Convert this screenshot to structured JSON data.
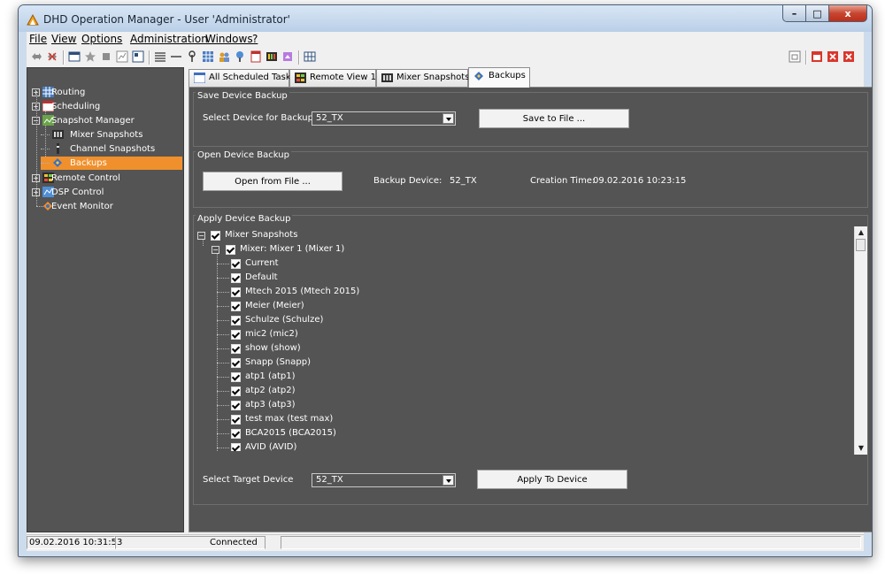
{
  "window": {
    "title": "DHD Operation Manager - User 'Administrator'",
    "buttons": {
      "minimize": "–",
      "maximize": "□",
      "close": "x"
    }
  },
  "menu": [
    "File",
    "View",
    "Options",
    "Administration",
    "Windows",
    "?"
  ],
  "sidebar": {
    "items": [
      {
        "label": "Routing",
        "icon": "routing-icon"
      },
      {
        "label": "Scheduling",
        "icon": "scheduling-icon"
      },
      {
        "label": "Snapshot Manager",
        "icon": "snapshot-manager-icon"
      },
      {
        "label": "Mixer Snapshots",
        "icon": "mixer-icon"
      },
      {
        "label": "Channel Snapshots",
        "icon": "channel-icon"
      },
      {
        "label": "Backups",
        "icon": "backups-icon",
        "selected": true
      },
      {
        "label": "Remote Control",
        "icon": "remote-control-icon"
      },
      {
        "label": "DSP Control",
        "icon": "dsp-control-icon"
      },
      {
        "label": "Event Monitor",
        "icon": "event-monitor-icon"
      }
    ]
  },
  "tabs": [
    {
      "label": "All Scheduled Tasks"
    },
    {
      "label": "Remote View 1"
    },
    {
      "label": "Mixer Snapshots"
    },
    {
      "label": "Backups",
      "active": true
    }
  ],
  "save_backup": {
    "group_title": "Save Device Backup",
    "select_label": "Select Device for Backup",
    "device_value": "52_TX",
    "save_button": "Save to File ..."
  },
  "open_backup": {
    "group_title": "Open Device Backup",
    "open_button": "Open from File ...",
    "backup_device_label": "Backup Device:",
    "backup_device_value": "52_TX",
    "creation_time_label": "Creation Time:",
    "creation_time_value": "09.02.2016 10:23:15"
  },
  "apply_backup": {
    "group_title": "Apply Device Backup",
    "root": "Mixer Snapshots",
    "mixer": "Mixer: Mixer 1 (Mixer 1)",
    "snapshots": [
      "Current",
      "Default",
      "Mtech  2015 (Mtech  2015)",
      "Meier (Meier)",
      "Schulze (Schulze)",
      "mic2 (mic2)",
      "show (show)",
      "Snapp (Snapp)",
      "atp1 (atp1)",
      "atp2 (atp2)",
      "atp3 (atp3)",
      "test max (test max)",
      "BCA2015 (BCA2015)",
      "AVID (AVID)"
    ],
    "target_label": "Select Target Device",
    "target_value": "52_TX",
    "apply_button": "Apply To Device"
  },
  "status": {
    "time": "09.02.2016 10:31:53",
    "connection": "Connected"
  },
  "colors": {
    "panel_bg": "#545454",
    "selected": "#f0902c",
    "text": "#ffffff"
  }
}
